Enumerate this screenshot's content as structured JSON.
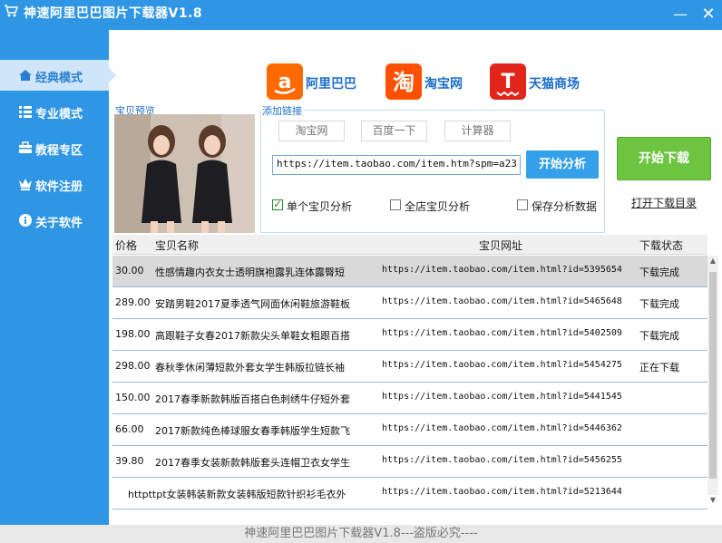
{
  "window": {
    "title": "神速阿里巴巴图片下载器V1.8",
    "minimize": "—",
    "close": "✕"
  },
  "sidebar": {
    "items": [
      {
        "label": "经典模式",
        "icon": "home-icon",
        "active": true
      },
      {
        "label": "专业模式",
        "icon": "list-icon",
        "active": false
      },
      {
        "label": "教程专区",
        "icon": "toolbox-icon",
        "active": false
      },
      {
        "label": "软件注册",
        "icon": "crown-icon",
        "active": false
      },
      {
        "label": "关于软件",
        "icon": "info-icon",
        "active": false
      }
    ]
  },
  "logos": {
    "alibaba": {
      "glyph": "a",
      "label": "阿里巴巴"
    },
    "taobao": {
      "glyph": "淘",
      "label": "淘宝网"
    },
    "tmall": {
      "glyph": "T",
      "label": "天猫商场"
    }
  },
  "preview": {
    "label": "宝贝预览"
  },
  "link_panel": {
    "label": "添加链接",
    "quick_buttons": [
      "淘宝网",
      "百度一下",
      "计算器"
    ],
    "url_value": "https://item.taobao.com/item.htm?spm=a23",
    "analyze_label": "开始分析",
    "options": [
      {
        "label": "单个宝贝分析",
        "checked": true
      },
      {
        "label": "全店宝贝分析",
        "checked": false
      },
      {
        "label": "保存分析数据",
        "checked": false
      }
    ]
  },
  "actions": {
    "download_label": "开始下载",
    "open_dir_label": "打开下载目录"
  },
  "table": {
    "columns": [
      "价格",
      "宝贝名称",
      "宝贝网址",
      "下载状态"
    ],
    "rows": [
      {
        "price": "30.00",
        "name": "性感情趣内衣女士透明旗袍露乳连体露臀短",
        "url": "https://item.taobao.com/item.html?id=5395654",
        "status": "下载完成",
        "selected": true
      },
      {
        "price": "289.00",
        "name": "安踏男鞋2017夏季透气网面休闲鞋旅游鞋板",
        "url": "https://item.taobao.com/item.html?id=5465648",
        "status": "下载完成",
        "selected": false
      },
      {
        "price": "198.00",
        "name": "高跟鞋子女春2017新款尖头单鞋女粗跟百搭",
        "url": "https://item.taobao.com/item.html?id=5402509",
        "status": "下载完成",
        "selected": false
      },
      {
        "price": "298.00",
        "name": "春秋季休闲薄短款外套女学生韩版拉链长袖",
        "url": "https://item.taobao.com/item.html?id=5454275",
        "status": "正在下载",
        "selected": false
      },
      {
        "price": "150.00",
        "name": "2017春季新款韩版百搭白色刺绣牛仔短外套",
        "url": "https://item.taobao.com/item.html?id=5441545",
        "status": "",
        "selected": false
      },
      {
        "price": "66.00",
        "name": "2017新款纯色棒球服女春季韩版学生短款飞",
        "url": "https://item.taobao.com/item.html?id=5446362",
        "status": "",
        "selected": false
      },
      {
        "price": "39.80",
        "name": "2017春季女装新款韩版套头连帽卫衣女学生",
        "url": "https://item.taobao.com/item.html?id=5456255",
        "status": "",
        "selected": false
      },
      {
        "price": "",
        "name": "httpttpt女装韩装新款女装韩版短款针织衫毛衣外",
        "url": "https://item.taobao.com/item.html?id=5213644",
        "status": "",
        "selected": false
      }
    ]
  },
  "footer": {
    "text": "神速阿里巴巴图片下载器V1.8---盗版必究----"
  },
  "colors": {
    "primary": "#2f96e6",
    "download_green": "#6dc441",
    "analyze_blue": "#34a0ea"
  }
}
